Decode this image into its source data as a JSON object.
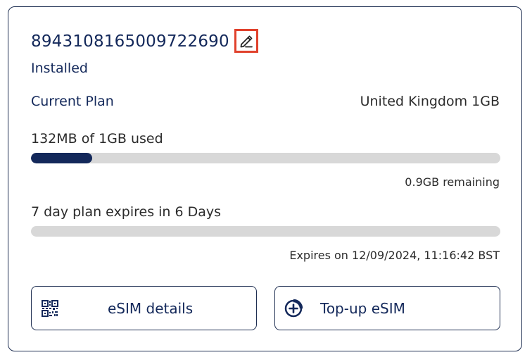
{
  "esim": {
    "iccid": "8943108165009722690",
    "status": "Installed",
    "edit_icon": "pencil-edit-icon"
  },
  "plan": {
    "label": "Current Plan",
    "name": "United Kingdom 1GB"
  },
  "usage": {
    "label": "132MB of 1GB used",
    "used_fraction": 0.13,
    "remaining": "0.9GB remaining"
  },
  "expiry": {
    "label": "7 day plan expires in 6 Days",
    "elapsed_fraction": 0.0,
    "expires_on": "Expires on 12/09/2024, 11:16:42 BST"
  },
  "actions": {
    "details_label": "eSIM details",
    "details_icon": "qr-code-icon",
    "topup_label": "Top-up eSIM",
    "topup_icon": "plus-circle-icon"
  },
  "colors": {
    "primary": "#13285a",
    "highlight": "#e0412c",
    "track": "#d8d8d8"
  }
}
